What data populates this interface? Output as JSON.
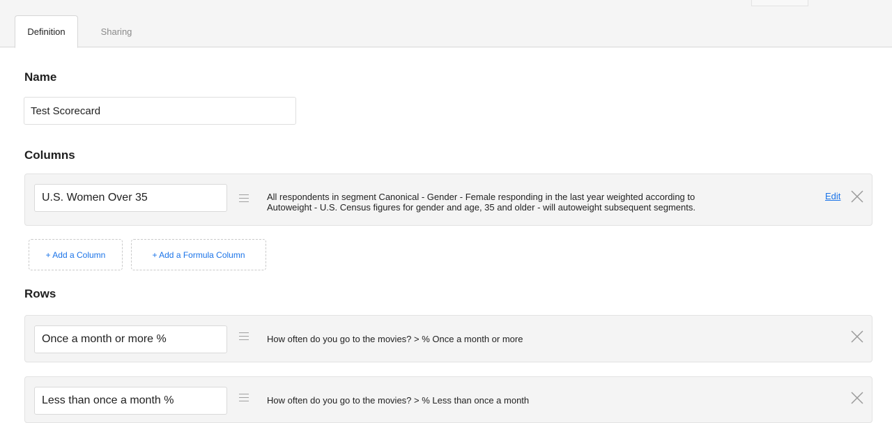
{
  "tabs": [
    {
      "label": "Definition",
      "active": true
    },
    {
      "label": "Sharing",
      "active": false
    }
  ],
  "name_section": {
    "title": "Name",
    "value": "Test Scorecard"
  },
  "columns_section": {
    "title": "Columns",
    "items": [
      {
        "value": "U.S. Women Over 35",
        "description_line1": "All respondents in segment Canonical - Gender - Female responding in the last year weighted according to",
        "description_line2": "Autoweight - U.S. Census figures for gender and age, 35 and older - will autoweight subsequent segments.",
        "edit_label": "Edit"
      }
    ],
    "add_column_label": "+ Add a Column",
    "add_formula_column_label": "+ Add a Formula Column"
  },
  "rows_section": {
    "title": "Rows",
    "items": [
      {
        "value": "Once a month or more %",
        "description": "How often do you go to the movies? > % Once a month or more"
      },
      {
        "value": "Less than once a month %",
        "description": "How often do you go to the movies? > % Less than once a month"
      }
    ]
  },
  "colors": {
    "link": "#1a73e8",
    "item_background": "#f4f4f4",
    "topbar_background": "#f5f5f5"
  },
  "icons": {
    "drag": "drag-handle-icon",
    "remove": "close-icon"
  }
}
